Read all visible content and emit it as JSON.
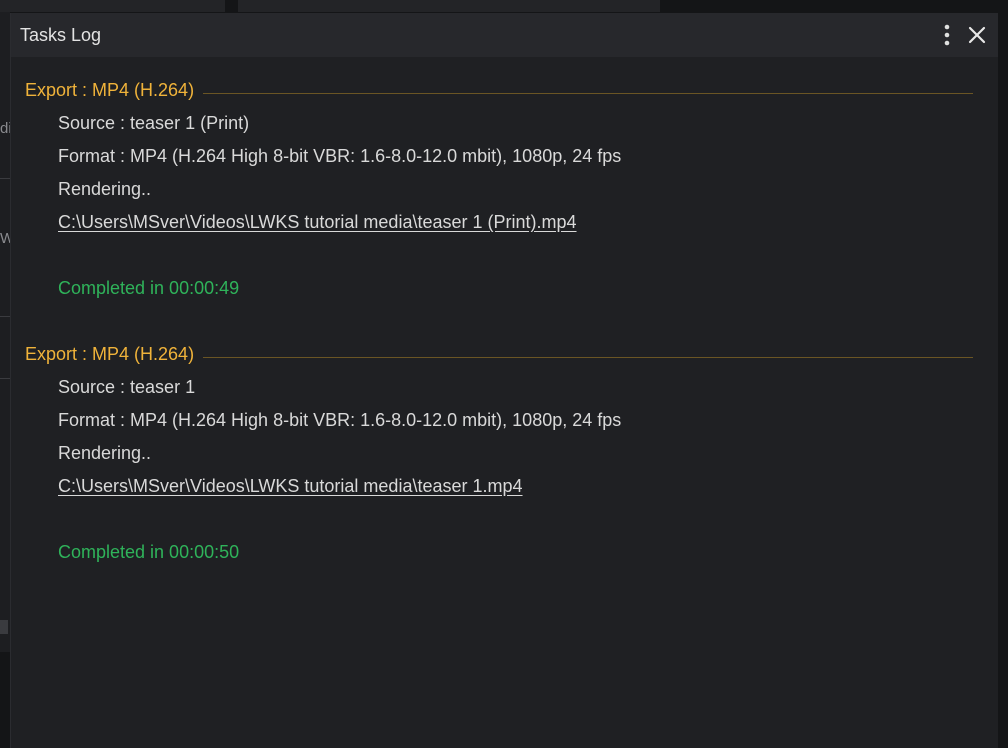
{
  "window": {
    "title": "Tasks Log"
  },
  "background": {
    "left_fragments": [
      "di",
      "W"
    ]
  },
  "tasks": [
    {
      "header": "Export : MP4 (H.264)",
      "source": "Source : teaser 1 (Print)",
      "format": "Format : MP4 (H.264 High 8-bit VBR: 1.6-8.0-12.0 mbit), 1080p, 24 fps",
      "status": "Rendering..",
      "path": "C:\\Users\\MSver\\Videos\\LWKS tutorial media\\teaser 1 (Print).mp4",
      "completed": "Completed in 00:00:49"
    },
    {
      "header": "Export : MP4 (H.264)",
      "source": "Source : teaser 1",
      "format": "Format : MP4 (H.264 High 8-bit VBR: 1.6-8.0-12.0 mbit), 1080p, 24 fps",
      "status": "Rendering..",
      "path": "C:\\Users\\MSver\\Videos\\LWKS tutorial media\\teaser 1.mp4",
      "completed": "Completed in 00:00:50"
    }
  ],
  "icons": {
    "menu": "vertical-dots-icon",
    "close": "close-icon"
  },
  "colors": {
    "header": "#f0b33a",
    "completed": "#2fb35a",
    "text": "#d9d9d9",
    "window_bg": "#1f2023",
    "titlebar_bg": "#27282c"
  }
}
